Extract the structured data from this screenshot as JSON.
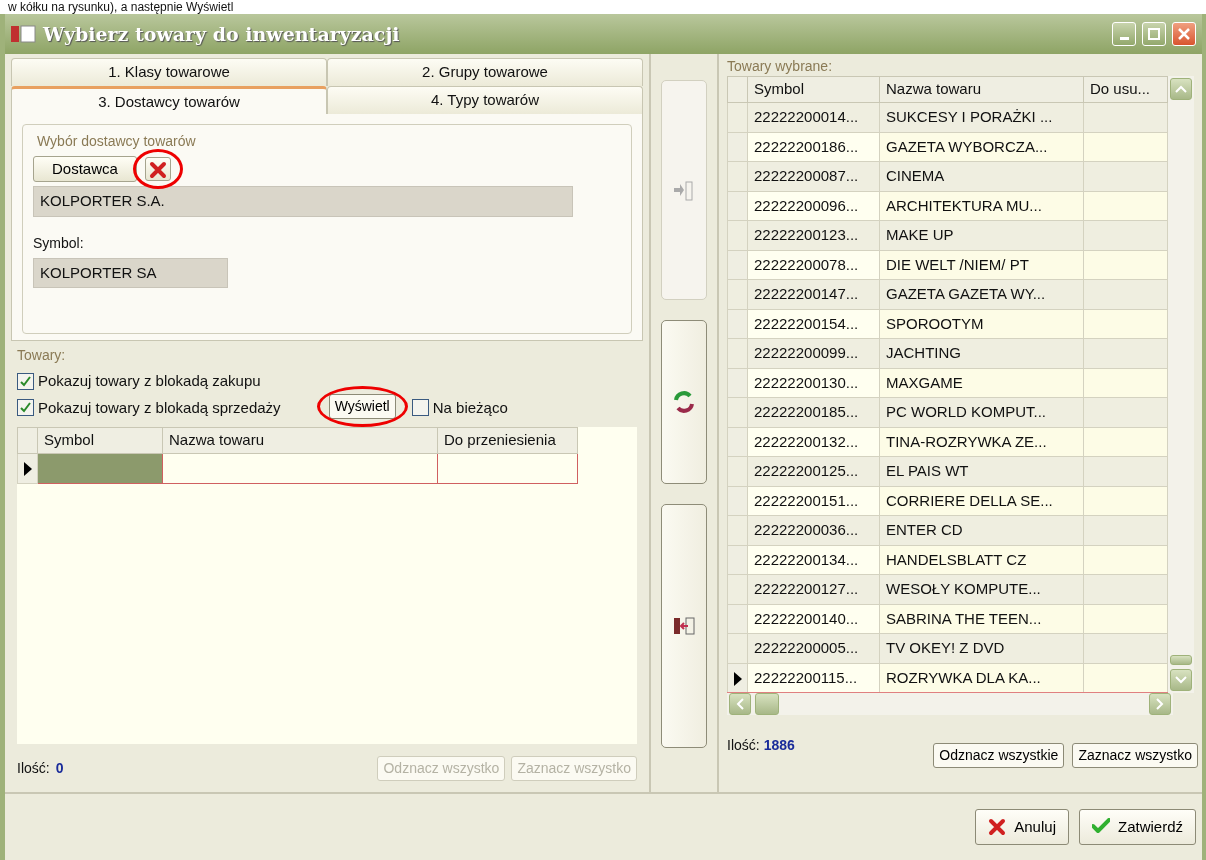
{
  "caption": "w kółku na rysunku), a następnie Wyświetl",
  "window": {
    "title": "Wybierz towary do inwentaryzacji"
  },
  "tabs": [
    {
      "label": "1. Klasy towarowe",
      "selected": false
    },
    {
      "label": "2. Grupy towarowe",
      "selected": false
    },
    {
      "label": "3. Dostawcy towarów",
      "selected": true
    },
    {
      "label": "4. Typy towarów",
      "selected": false
    }
  ],
  "supplier": {
    "title": "Wybór dostawcy towarów",
    "button": "Dostawca",
    "clear_circled": true,
    "name_value": "KOLPORTER S.A.",
    "symbol_label": "Symbol:",
    "symbol_value": "KOLPORTER SA"
  },
  "goods": {
    "title": "Towary:",
    "options": [
      {
        "label": "Pokazuj towary z blokadą zakupu",
        "checked": true
      },
      {
        "label": "Pokazuj towary z blokadą sprzedaży",
        "checked": true
      }
    ],
    "show_button": {
      "label": "Wyświetl",
      "circled": true
    },
    "live": {
      "label": "Na bieżąco",
      "checked": false
    },
    "columns": [
      "Symbol",
      "Nazwa towaru",
      "Do przeniesienia"
    ],
    "rows": [
      {
        "current": true
      }
    ],
    "count_label": "Ilość:",
    "count": "0",
    "buttons": [
      {
        "label": "Odznacz wszystko",
        "disabled": true
      },
      {
        "label": "Zaznacz wszystko",
        "disabled": true
      }
    ]
  },
  "transfer_buttons": [
    {
      "kind": "add",
      "disabled": true
    },
    {
      "kind": "refresh",
      "disabled": false
    },
    {
      "kind": "remove",
      "disabled": false
    }
  ],
  "selected_goods": {
    "title": "Towary wybrane:",
    "columns": [
      "Symbol",
      "Nazwa towaru",
      "Do usu..."
    ],
    "rows": [
      {
        "symbol": "22222200014...",
        "name": "SUKCESY I PORAŻKI ...",
        "current": false
      },
      {
        "symbol": "22222200186...",
        "name": "GAZETA WYBORCZA...",
        "current": false
      },
      {
        "symbol": "22222200087...",
        "name": "CINEMA",
        "current": false
      },
      {
        "symbol": "22222200096...",
        "name": "ARCHITEKTURA MU...",
        "current": false
      },
      {
        "symbol": "22222200123...",
        "name": "MAKE UP",
        "current": false
      },
      {
        "symbol": "22222200078...",
        "name": "DIE WELT /NIEM/ PT",
        "current": false
      },
      {
        "symbol": "22222200147...",
        "name": "GAZETA GAZETA WY...",
        "current": false
      },
      {
        "symbol": "22222200154...",
        "name": "SPOROOTYM",
        "current": false
      },
      {
        "symbol": "22222200099...",
        "name": "JACHTING",
        "current": false
      },
      {
        "symbol": "22222200130...",
        "name": "MAXGAME",
        "current": false
      },
      {
        "symbol": "22222200185...",
        "name": "PC WORLD KOMPUT...",
        "current": false
      },
      {
        "symbol": "22222200132...",
        "name": "TINA-ROZRYWKA ZE...",
        "current": false
      },
      {
        "symbol": "22222200125...",
        "name": "EL PAIS WT",
        "current": false
      },
      {
        "symbol": "22222200151...",
        "name": "CORRIERE DELLA SE...",
        "current": false
      },
      {
        "symbol": "22222200036...",
        "name": "ENTER CD",
        "current": false
      },
      {
        "symbol": "22222200134...",
        "name": "HANDELSBLATT CZ",
        "current": false
      },
      {
        "symbol": "22222200127...",
        "name": "WESOŁY KOMPUTE...",
        "current": false
      },
      {
        "symbol": "22222200140...",
        "name": "SABRINA THE TEEN...",
        "current": false
      },
      {
        "symbol": "22222200005...",
        "name": "TV OKEY! Z DVD",
        "current": false
      },
      {
        "symbol": "22222200115...",
        "name": "ROZRYWKA DLA KA...",
        "current": true
      }
    ],
    "count_label": "Ilość:",
    "count": "1886",
    "buttons": [
      {
        "label": "Odznacz wszystkie",
        "disabled": false
      },
      {
        "label": "Zaznacz wszystko",
        "disabled": false
      }
    ]
  },
  "footer": {
    "buttons": [
      {
        "kind": "cancel",
        "label": "Anuluj"
      },
      {
        "kind": "confirm",
        "label": "Zatwierdź"
      }
    ]
  }
}
